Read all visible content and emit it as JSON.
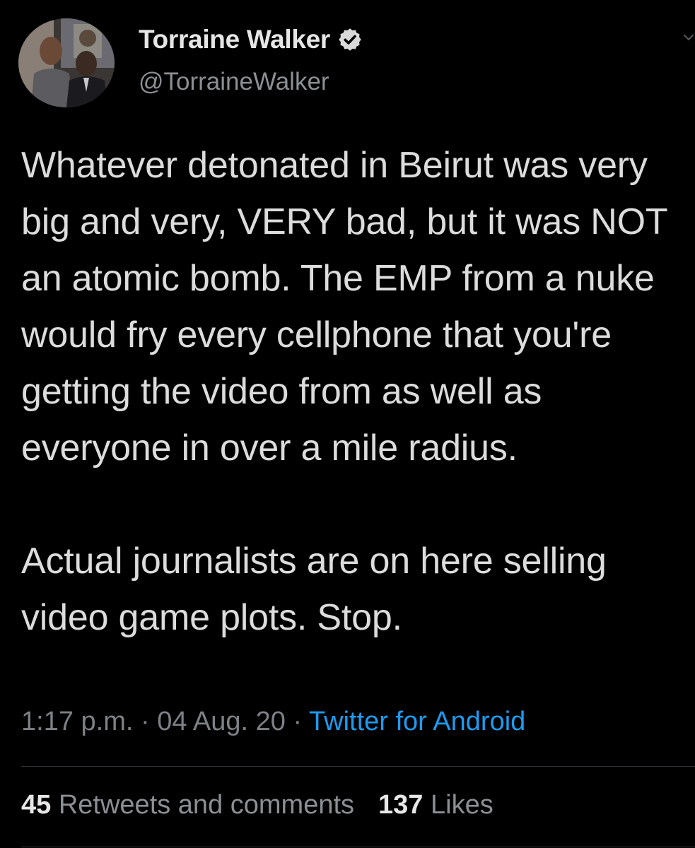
{
  "author": {
    "display_name": "Torraine Walker",
    "handle": "@TorraineWalker",
    "verified": true,
    "avatar_icon": "profile-photo"
  },
  "tweet": {
    "paragraphs": [
      "Whatever detonated in Beirut was very big and very, VERY bad, but it was NOT an atomic bomb. The EMP from a nuke would fry every cellphone that you're getting the video from as well as everyone in over a mile radius.",
      "Actual journalists are on here selling video game plots. Stop."
    ],
    "time": "1:17 p.m.",
    "separator": "·",
    "date": "04 Aug. 20",
    "source": "Twitter for Android"
  },
  "stats": {
    "retweets_count": "45",
    "retweets_label": "Retweets and comments",
    "likes_count": "137",
    "likes_label": "Likes"
  },
  "colors": {
    "background": "#000000",
    "link": "#1d9bf0",
    "verified_badge": "#d9d9d9"
  }
}
